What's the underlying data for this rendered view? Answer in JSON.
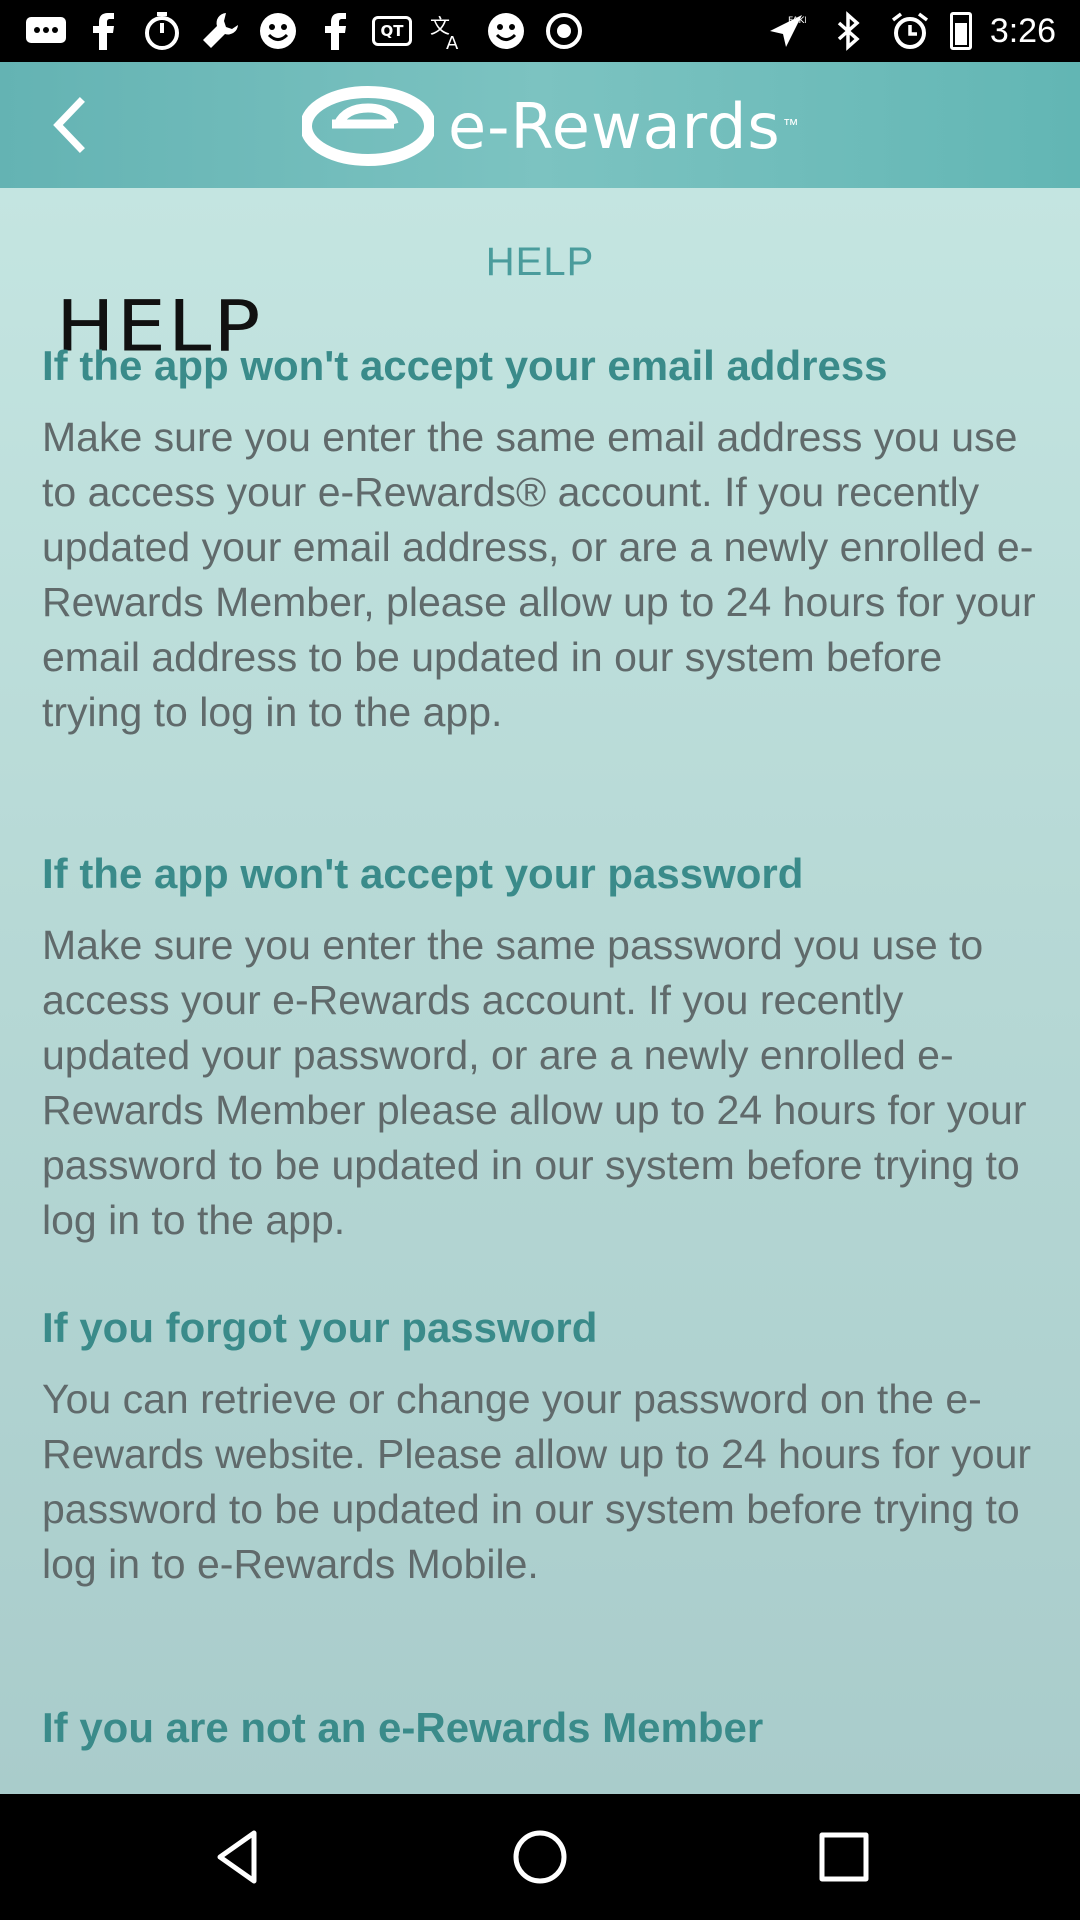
{
  "status_bar": {
    "time": "3:26",
    "left_icons": [
      "message-icon",
      "facebook-icon",
      "timer-icon",
      "wrench-icon",
      "smiley-icon",
      "facebook-icon",
      "qt-icon",
      "translate-icon",
      "smiley-icon",
      "circle-icon"
    ],
    "right_icons": [
      "fake-gps-icon",
      "bluetooth-icon",
      "alarm-icon",
      "battery-icon"
    ],
    "qt_label": "QT"
  },
  "app_bar": {
    "back_icon": "back-arrow-icon",
    "logo_text": "e-Rewards",
    "logo_tm": "™"
  },
  "content": {
    "heading": "HELP",
    "handwritten": "HELP",
    "sections": [
      {
        "title": "If the app won't accept your email address",
        "body": "Make sure you enter the same email address you use to access your e-Rewards® account. If you recently updated your email address, or are a newly enrolled e-Rewards Member, please allow up to 24 hours for your email address to be updated in our system before trying to log in to the app."
      },
      {
        "title": "If the app won't accept your password",
        "body": "Make sure you enter the same password you use to access your e-Rewards account. If you recently updated your password, or are a newly enrolled e-Rewards Member please allow up to 24 hours for your password to be updated in our system before trying to log in to the app."
      },
      {
        "title": "If you forgot your password",
        "body": "You can retrieve or change your password on the e-Rewards website. Please allow up to 24 hours for your password to be updated in our system before trying to log in to e-Rewards Mobile."
      },
      {
        "title": "If you are not an e-Rewards Member",
        "body": ""
      }
    ]
  },
  "nav_bar": {
    "buttons": [
      "back-triangle-icon",
      "home-circle-icon",
      "recents-square-icon"
    ]
  },
  "colors": {
    "app_bar": "#6cbab8",
    "section_title": "#3a8b8a",
    "body_text": "#606a6b",
    "help_heading": "#4a9c9c"
  }
}
